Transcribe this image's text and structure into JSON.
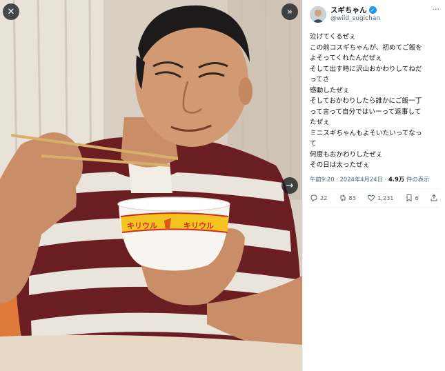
{
  "media": {
    "close_icon": "close-icon",
    "collapse_icon": "chevron-double-right-icon",
    "next_icon": "arrow-right-icon",
    "close_glyph": "✕",
    "collapse_glyph": "»",
    "next_glyph": "→",
    "bowl_text_left": "キリウル",
    "bowl_text_right": "キリウル"
  },
  "tweet": {
    "display_name": "スギちゃん",
    "verified_glyph": "✓",
    "handle": "@wild_sugichan",
    "more_glyph": "···",
    "lines": [
      "泣けてくるぜぇ",
      "この前コスギちゃんが、初めてご飯を",
      "よそってくれたんだぜぇ",
      "そして出す時に沢山おかわりしてねだ",
      "ってさ",
      "感動したぜぇ",
      "そしておかわりしたら誰かにご飯一丁",
      "って言って自分ではいーって返事して",
      "たぜぇ",
      "ミニスギちゃんもよそいたいってなっ",
      "て",
      "何度もおかわりしたぜぇ",
      "その日は太ったぜぇ"
    ],
    "timestamp": "午前9:20 · 2024年4月24日 · ",
    "views_count": "4.9万",
    "views_label": " 件の表示",
    "actions": {
      "replies": "22",
      "reposts": "83",
      "likes": "1,231",
      "bookmarks": "6"
    }
  },
  "colors": {
    "accent": "#1d9bf0",
    "text": "#0f1419",
    "muted": "#536471"
  }
}
